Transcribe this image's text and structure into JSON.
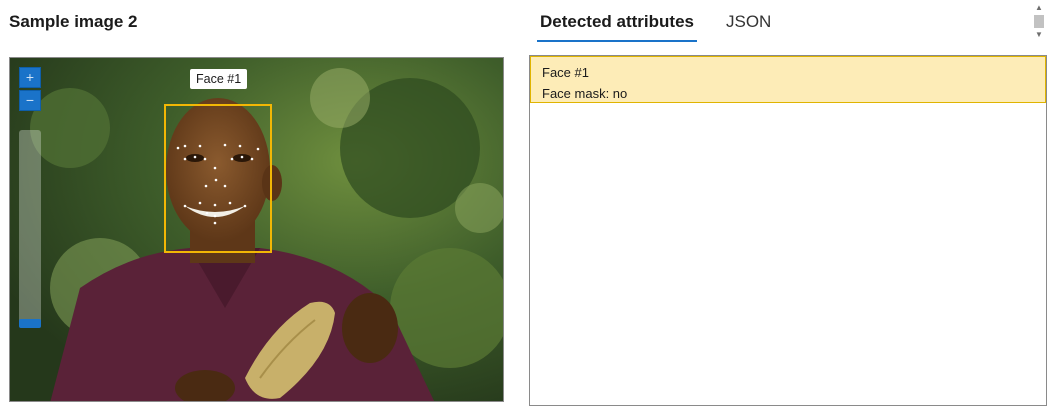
{
  "header": {
    "title": "Sample image 2"
  },
  "viewer": {
    "zoom_in_symbol": "+",
    "zoom_out_symbol": "−",
    "face_label": "Face #1"
  },
  "tabs": [
    {
      "label": "Detected attributes",
      "active": true
    },
    {
      "label": "JSON",
      "active": false
    }
  ],
  "results": [
    {
      "name": "Face #1",
      "attribute": "Face mask: no"
    }
  ],
  "colors": {
    "accent": "#1a73c9",
    "face_box": "#f2b705",
    "selected_row_bg": "#fdecb7"
  }
}
